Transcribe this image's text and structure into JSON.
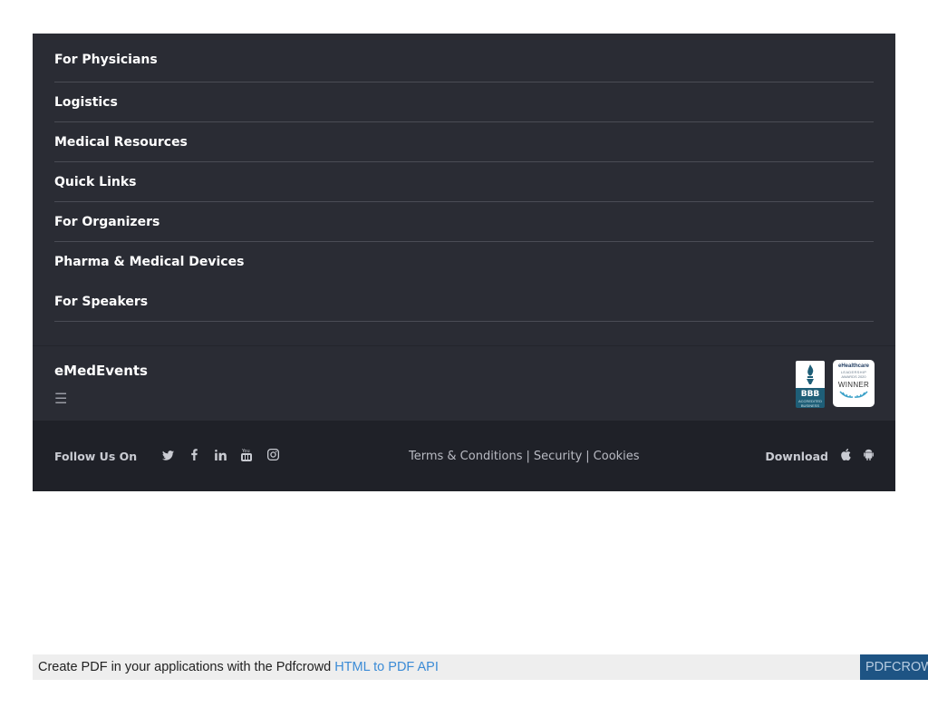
{
  "menu": {
    "items": [
      {
        "label": "For Physicians"
      },
      {
        "label": "Logistics"
      },
      {
        "label": "Medical Resources"
      },
      {
        "label": "Quick Links"
      },
      {
        "label": "For Organizers"
      },
      {
        "label": "Pharma & Medical Devices"
      },
      {
        "label": "For Speakers"
      }
    ]
  },
  "brand": {
    "name": "eMedEvents",
    "menu_icon": "☰",
    "bbb_badge": {
      "text": "BBB",
      "sub": "ACCREDITED BUSINESS"
    },
    "award_badge": {
      "line1": "eHealthcare",
      "line2": "LEADERSHIP",
      "line3": "AWARDS 2020",
      "line4": "WINNER"
    }
  },
  "footer": {
    "follow_label": "Follow Us On",
    "social_icons": [
      "twitter-icon",
      "facebook-icon",
      "linkedin-icon",
      "youtube-icon",
      "instagram-icon"
    ],
    "links": {
      "terms": "Terms & Conditions",
      "security": "Security",
      "cookies": "Cookies",
      "separator": "|"
    },
    "download_label": "Download",
    "download_icons": [
      "apple-icon",
      "android-icon"
    ]
  },
  "pdf_bar": {
    "text": "Create PDF in your applications with the Pdfcrowd",
    "link": "HTML to PDF API",
    "logo": "PDFCROWD"
  },
  "colors": {
    "menu_bg": "#2a2c34",
    "bottom_bg": "#1f2128",
    "divider": "#4a4c55",
    "link_blue": "#3b8bd6",
    "pdf_logo_bg": "#1e5484"
  }
}
